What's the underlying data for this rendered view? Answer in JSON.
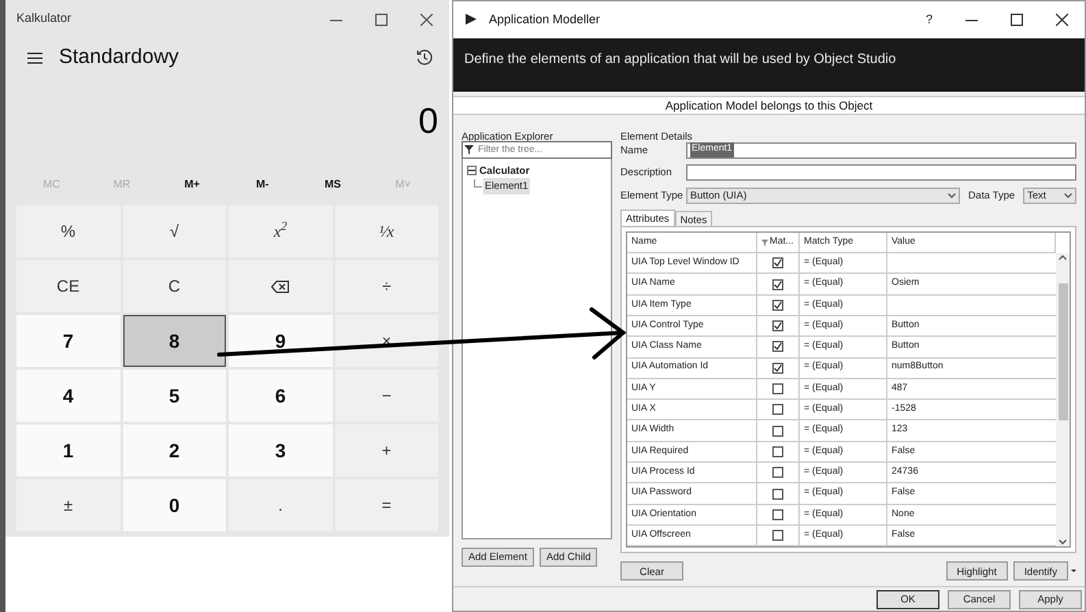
{
  "calculator": {
    "title": "Kalkulator",
    "mode": "Standardowy",
    "display": "0",
    "memory": [
      {
        "label": "MC",
        "disabled": true
      },
      {
        "label": "MR",
        "disabled": true
      },
      {
        "label": "M+",
        "disabled": false
      },
      {
        "label": "M-",
        "disabled": false
      },
      {
        "label": "MS",
        "disabled": false
      },
      {
        "label": "M˅",
        "disabled": true
      }
    ],
    "keys": [
      {
        "kind": "op",
        "label": "%",
        "selected": false
      },
      {
        "kind": "op",
        "label": "√",
        "selected": false
      },
      {
        "kind": "math",
        "label": "x$^{2}$",
        "selected": false
      },
      {
        "kind": "math",
        "label": "¹⁄x",
        "selected": false
      },
      {
        "kind": "op",
        "label": "CE",
        "selected": false
      },
      {
        "kind": "op",
        "label": "C",
        "selected": false
      },
      {
        "kind": "backspace",
        "selected": false
      },
      {
        "kind": "op",
        "label": "÷",
        "selected": false
      },
      {
        "kind": "digit",
        "label": "7",
        "selected": false
      },
      {
        "kind": "digit",
        "label": "8",
        "selected": true
      },
      {
        "kind": "digit",
        "label": "9",
        "selected": false
      },
      {
        "kind": "op",
        "label": "×",
        "selected": false
      },
      {
        "kind": "digit",
        "label": "4",
        "selected": false
      },
      {
        "kind": "digit",
        "label": "5",
        "selected": false
      },
      {
        "kind": "digit",
        "label": "6",
        "selected": false
      },
      {
        "kind": "op",
        "label": "−",
        "selected": false
      },
      {
        "kind": "digit",
        "label": "1",
        "selected": false
      },
      {
        "kind": "digit",
        "label": "2",
        "selected": false
      },
      {
        "kind": "digit",
        "label": "3",
        "selected": false
      },
      {
        "kind": "op",
        "label": "+",
        "selected": false
      },
      {
        "kind": "op",
        "label": "±",
        "selected": false
      },
      {
        "kind": "digit",
        "label": "0",
        "selected": false
      },
      {
        "kind": "op",
        "label": ".",
        "selected": false
      },
      {
        "kind": "op",
        "label": "=",
        "selected": false
      }
    ]
  },
  "modeller": {
    "title": "Application Modeller",
    "title_buttons": [
      "?"
    ],
    "banner": "Define the elements of an application that will be used by Object Studio",
    "subtitle": "Application Model belongs to this Object",
    "explorer": {
      "heading": "Application Explorer",
      "filter_placeholder": "Filter the tree...",
      "tree": [
        {
          "label": "Calculator",
          "expanded": true,
          "children": [
            {
              "label": "Element1",
              "selected": true
            }
          ]
        }
      ]
    },
    "details": {
      "heading": "Element Details",
      "name_label": "Name",
      "name_value": "Element1",
      "description_label": "Description",
      "element_type_label": "Element Type",
      "element_type": "Button (UIA)",
      "data_type_label": "Data Type",
      "data_type": "Text"
    },
    "tabs": [
      {
        "label": "Attributes",
        "selected": true
      },
      {
        "label": "Notes",
        "selected": false
      }
    ],
    "columns": [
      "Name",
      "Mat...",
      "Match Type",
      "Value"
    ],
    "rows": [
      {
        "name": "UIA Top Level Window ID",
        "checked": true,
        "match": "= (Equal)",
        "value": ""
      },
      {
        "name": "UIA Name",
        "checked": true,
        "match": "= (Equal)",
        "value": "Osiem"
      },
      {
        "name": "UIA Item Type",
        "checked": true,
        "match": "= (Equal)",
        "value": ""
      },
      {
        "name": "UIA Control Type",
        "checked": true,
        "match": "= (Equal)",
        "value": "Button"
      },
      {
        "name": "UIA Class Name",
        "checked": true,
        "match": "= (Equal)",
        "value": "Button"
      },
      {
        "name": "UIA Automation Id",
        "checked": true,
        "match": "= (Equal)",
        "value": "num8Button"
      },
      {
        "name": "UIA Y",
        "checked": false,
        "match": "= (Equal)",
        "value": "487"
      },
      {
        "name": "UIA X",
        "checked": false,
        "match": "= (Equal)",
        "value": "-1528"
      },
      {
        "name": "UIA Width",
        "checked": false,
        "match": "= (Equal)",
        "value": "123"
      },
      {
        "name": "UIA Required",
        "checked": false,
        "match": "= (Equal)",
        "value": "False"
      },
      {
        "name": "UIA Process Id",
        "checked": false,
        "match": "= (Equal)",
        "value": "24736"
      },
      {
        "name": "UIA Password",
        "checked": false,
        "match": "= (Equal)",
        "value": "False"
      },
      {
        "name": "UIA Orientation",
        "checked": false,
        "match": "= (Equal)",
        "value": "None"
      },
      {
        "name": "UIA Offscreen",
        "checked": false,
        "match": "= (Equal)",
        "value": "False"
      }
    ],
    "left_buttons": [
      "Add Element",
      "Add Child"
    ],
    "clear_button": "Clear",
    "right_buttons": [
      "Highlight",
      "Identify"
    ],
    "footer_buttons": [
      "OK",
      "Cancel",
      "Apply"
    ]
  }
}
